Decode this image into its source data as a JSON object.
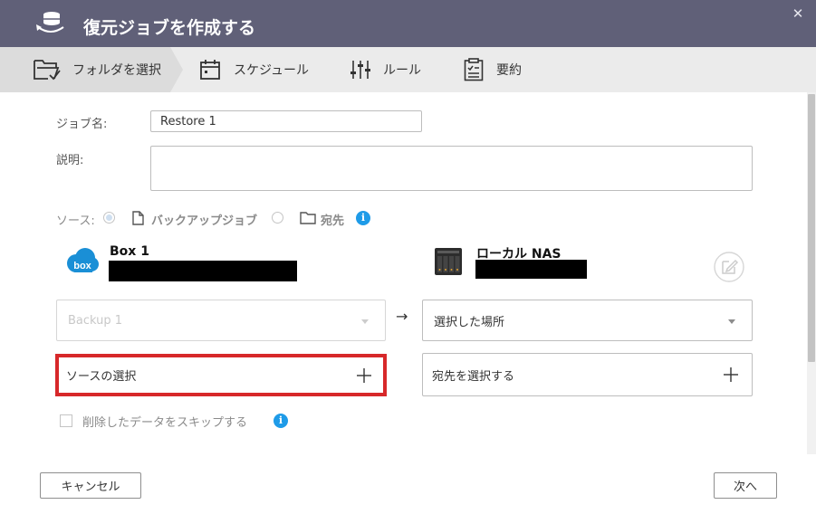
{
  "dialog": {
    "title": "復元ジョブを作成する",
    "close_glyph": "✕"
  },
  "steps": [
    {
      "label": "フォルダを選択",
      "icon": "folder-check-icon",
      "active": true
    },
    {
      "label": "スケジュール",
      "icon": "calendar-icon",
      "active": false
    },
    {
      "label": "ルール",
      "icon": "sliders-icon",
      "active": false
    },
    {
      "label": "要約",
      "icon": "clipboard-icon",
      "active": false
    }
  ],
  "form": {
    "job_name_label": "ジョブ名:",
    "job_name_value": "Restore 1",
    "description_label": "説明:",
    "description_value": "",
    "source_label": "ソース:",
    "source_options": [
      {
        "label": "バックアップジョブ",
        "checked": true,
        "icon": "file-icon"
      },
      {
        "label": "宛先",
        "checked": false,
        "icon": "folder-icon"
      }
    ],
    "info_glyph": "i"
  },
  "source_account": {
    "name": "Box 1",
    "logo_text": "box",
    "icon": "box-cloud-icon",
    "brand_color": "#1a8fd6"
  },
  "destination_account": {
    "name": "ローカル NAS",
    "icon": "nas-device-icon"
  },
  "selectors": {
    "source_select_value": "Backup 1",
    "arrow": "→",
    "destination_select_value": "選択した場所",
    "source_picker_label": "ソースの選択",
    "destination_picker_label": "宛先を選択する"
  },
  "options": {
    "skip_deleted_label": "削除したデータをスキップする",
    "skip_deleted_checked": false
  },
  "footer": {
    "cancel_label": "キャンセル",
    "next_label": "次へ"
  },
  "colors": {
    "titlebar": "#606078",
    "info": "#1e9be8",
    "highlight": "#d7282a"
  }
}
